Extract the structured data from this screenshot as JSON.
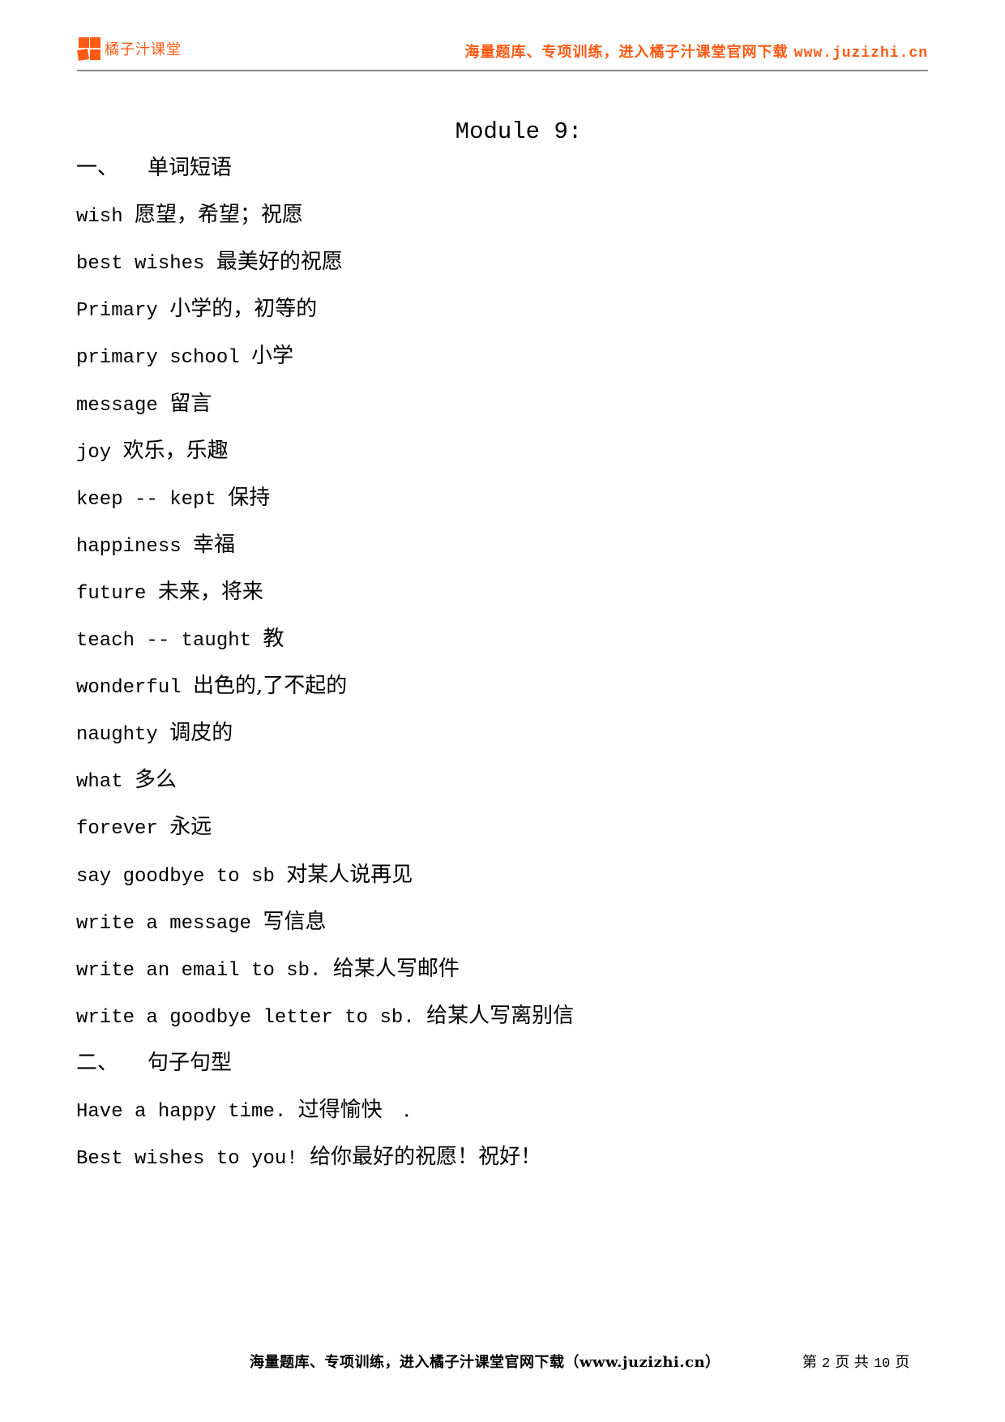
{
  "header": {
    "logo_text": "橘子汁课堂",
    "slogan": "海量题库、专项训练，进入橘子汁课堂官网下载",
    "slogan_url": "www.juzizhi.cn",
    "brand_color": "#ff5a14"
  },
  "title": "Module 9:",
  "sections": [
    {
      "number": "一、",
      "heading": "单词短语",
      "items": [
        {
          "en": "wish",
          "cn": "愿望，希望；祝愿"
        },
        {
          "en": "best wishes",
          "cn": "最美好的祝愿"
        },
        {
          "en": "Primary",
          "cn": "小学的，初等的"
        },
        {
          "en": "primary school",
          "cn": "小学"
        },
        {
          "en": "message",
          "cn": "留言"
        },
        {
          "en": "joy",
          "cn": "欢乐，乐趣"
        },
        {
          "en": "keep -- kept",
          "cn": "保持"
        },
        {
          "en": "happiness",
          "cn": "幸福"
        },
        {
          "en": "future",
          "cn": "未来，将来"
        },
        {
          "en": "teach -- taught",
          "cn": "教"
        },
        {
          "en": "wonderful",
          "cn": "出色的,了不起的"
        },
        {
          "en": "naughty",
          "cn": "调皮的"
        },
        {
          "en": "what",
          "cn": "多么"
        },
        {
          "en": "forever",
          "cn": "永远"
        },
        {
          "en": "say goodbye to sb",
          "cn": "对某人说再见"
        },
        {
          "en": "write a message",
          "cn": "写信息"
        },
        {
          "en": "write an email to sb.",
          "cn": "给某人写邮件"
        },
        {
          "en": "write a goodbye letter to sb.",
          "cn": "给某人写离别信"
        }
      ]
    },
    {
      "number": "二、",
      "heading": "句子句型",
      "items": [
        {
          "en": "Have a happy time.",
          "cn": "过得愉快　."
        },
        {
          "en": "Best wishes to you!",
          "cn": "给你最好的祝愿！祝好！"
        }
      ]
    }
  ],
  "footer": {
    "slogan": "海量题库、专项训练，进入橘子汁课堂官网下载（www.juzizhi.cn）",
    "page_prefix": "第",
    "page_current": "2",
    "page_middle": "页 共",
    "page_total": "10",
    "page_suffix": "页"
  }
}
